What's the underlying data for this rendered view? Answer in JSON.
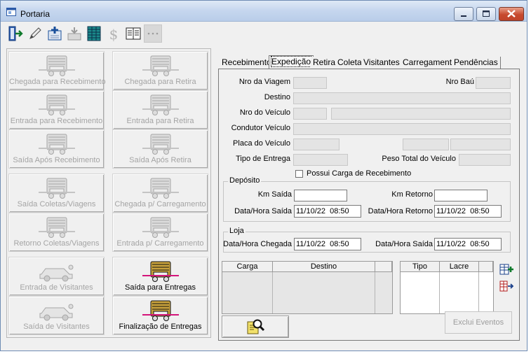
{
  "window": {
    "title": "Portaria",
    "controls": [
      "minimize-icon",
      "maximize-icon",
      "close-icon"
    ]
  },
  "toolbar": {
    "icons": [
      "exit-door-icon",
      "pencil-edit-icon",
      "add-record-icon",
      "import-icon",
      "grid-table-icon",
      "dollar-icon",
      "book-icon",
      "disabled-blank-icon"
    ]
  },
  "actions": [
    {
      "label": "Chegada para Recebimento",
      "icon": "truck-arrival-icon",
      "enabled": false
    },
    {
      "label": "Chegada para Retira",
      "icon": "truck-front-icon",
      "enabled": false
    },
    {
      "label": "Entrada para Recebimento",
      "icon": "truck-entry-icon",
      "enabled": false
    },
    {
      "label": "Entrada para Retira",
      "icon": "truck-entry-retira-icon",
      "enabled": false
    },
    {
      "label": "Saída Após Recebimento",
      "icon": "truck-exit-icon",
      "enabled": false
    },
    {
      "label": "Saída Após Retira",
      "icon": "truck-loaded-exit-icon",
      "enabled": false
    },
    {
      "label": "Saída Coletas/Viagens",
      "icon": "bus-exit-icon",
      "enabled": false
    },
    {
      "label": "Chegada p/ Carregamento",
      "icon": "truck-loading-arrival-icon",
      "enabled": false
    },
    {
      "label": "Retorno Coletas/Viagens",
      "icon": "truck-return-icon",
      "enabled": false
    },
    {
      "label": "Entrada p/ Carregamento",
      "icon": "truck-loading-entry-icon",
      "enabled": false
    },
    {
      "label": "Entrada de Visitantes",
      "icon": "car-visitor-entry-icon",
      "enabled": false
    },
    {
      "label": "Saída para Entregas",
      "icon": "truck-delivery-exit-icon",
      "enabled": true
    },
    {
      "label": "Saída de Visitantes",
      "icon": "car-visitor-exit-icon",
      "enabled": false
    },
    {
      "label": "Finalização de Entregas",
      "icon": "truck-delivery-finish-icon",
      "enabled": true
    }
  ],
  "tabs": [
    "Recebimento",
    "Expedição",
    "Retira",
    "Coleta",
    "Visitantes",
    "Carregamento",
    "Pendências"
  ],
  "active_tab": "Expedição",
  "form": {
    "nro_viagem": "Nro da Viagem",
    "nro_bau": "Nro Baú",
    "destino": "Destino",
    "nro_veiculo": "Nro do Veículo",
    "condutor": "Condutor Veículo",
    "placa": "Placa do Veículo",
    "tipo_entrega": "Tipo de Entrega",
    "peso_total": "Peso Total do Veículo",
    "possui_carga": "Possui Carga de Recebimento"
  },
  "deposito": {
    "title": "Depósito",
    "km_saida": "Km Saída",
    "km_retorno": "Km Retorno",
    "dh_saida_label": "Data/Hora Saída",
    "dh_saida_value": "11/10/22  08:50",
    "dh_retorno_label": "Data/Hora Retorno",
    "dh_retorno_value": "11/10/22  08:50"
  },
  "loja": {
    "title": "Loja",
    "dh_chegada_label": "Data/Hora Chegada",
    "dh_chegada_value": "11/10/22  08:50",
    "dh_saida_label": "Data/Hora Saída",
    "dh_saida_value": "11/10/22  08:50"
  },
  "grid_carga": {
    "columns": [
      "Carga",
      "Destino",
      ""
    ]
  },
  "grid_lacre": {
    "columns": [
      "Tipo",
      "Lacre",
      ""
    ]
  },
  "buttons": {
    "exclui_eventos": "Exclui Eventos",
    "search_icon": "magnifier-document-icon",
    "add_lacre_icon": "add-row-icon",
    "remove_lacre_icon": "remove-row-icon"
  },
  "colors": {
    "titlebar": "#c5d6ee",
    "close_button": "#c74a2e",
    "face": "#f0f0f0",
    "disabled_text": "#a4a4a4"
  }
}
